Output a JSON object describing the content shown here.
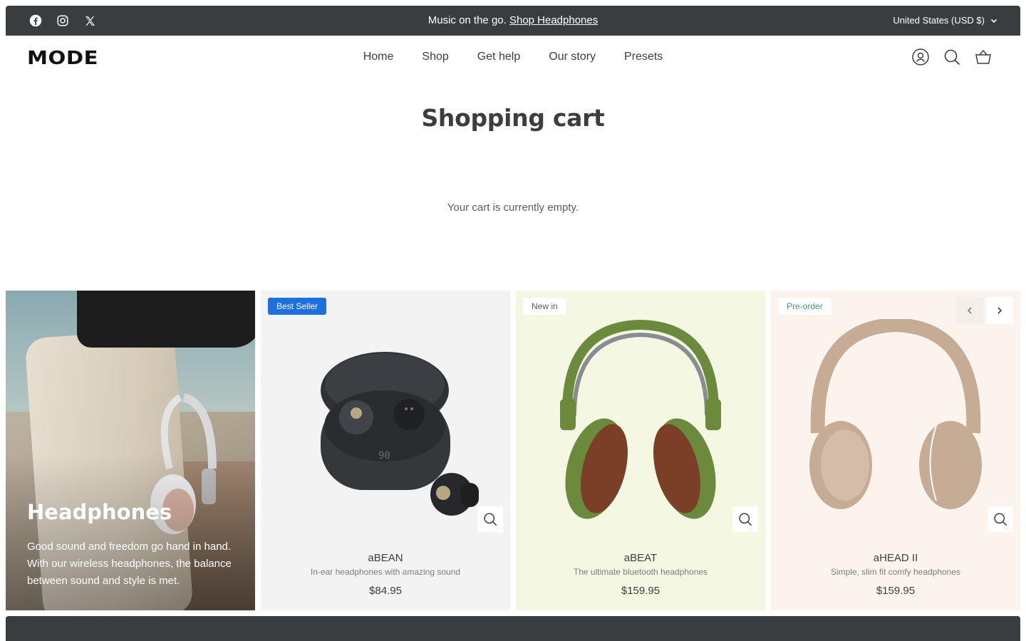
{
  "announcement": {
    "text": "Music on the go.",
    "link": "Shop Headphones",
    "currency": "United States (USD $)",
    "social": [
      "facebook-icon",
      "instagram-icon",
      "x-icon"
    ]
  },
  "header": {
    "logo": "MODE",
    "nav": [
      "Home",
      "Shop",
      "Get help",
      "Our story",
      "Presets"
    ]
  },
  "cart": {
    "title": "Shopping cart",
    "empty_message": "Your cart is currently empty."
  },
  "promo": {
    "title": "Headphones",
    "text": "Good sound and freedom go hand in hand. With our wireless headphones, the balance between sound and style is met."
  },
  "products": [
    {
      "badge": "Best Seller",
      "name": "aBEAN",
      "subtitle": "In-ear headphones with amazing sound",
      "price": "$84.95",
      "bg": "#f3f3f3",
      "badge_bg": "#1e6fe0",
      "badge_color": "#ffffff"
    },
    {
      "badge": "New in",
      "name": "aBEAT",
      "subtitle": "The ultimate bluetooth headphones",
      "price": "$159.95",
      "bg": "#f4f8e3",
      "badge_bg": "#ffffff",
      "badge_color": "#5a5d60"
    },
    {
      "badge": "Pre-order",
      "name": "aHEAD II",
      "subtitle": "Simple, slim fit comfy headphones",
      "price": "$159.95",
      "bg": "#fcf4ec",
      "badge_bg": "#ffffff",
      "badge_color": "#4a9a6a"
    }
  ],
  "earbud_display": "90"
}
